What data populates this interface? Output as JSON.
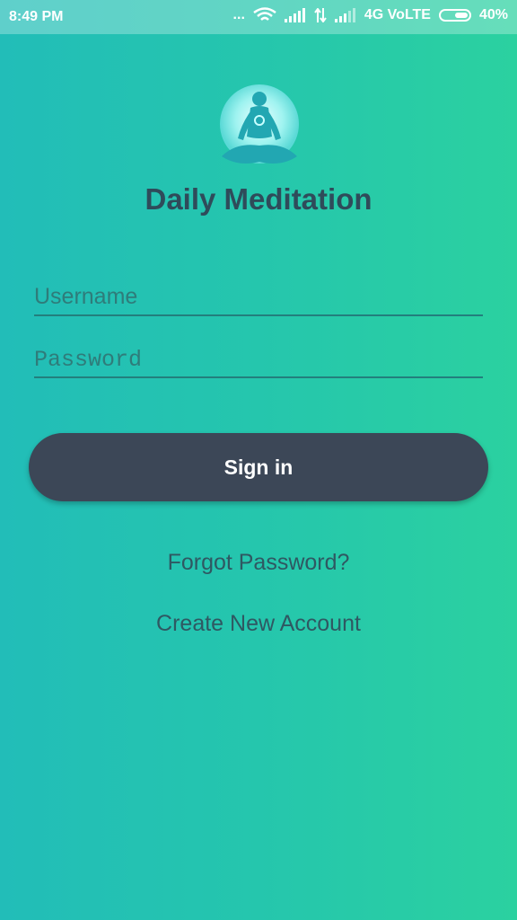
{
  "status_bar": {
    "time": "8:49 PM",
    "dots": "...",
    "network": "4G VoLTE",
    "battery": "40%",
    "battery_level": 0.4
  },
  "app": {
    "title": "Daily Meditation",
    "logo_icon": "meditation-figure-icon"
  },
  "form": {
    "username_placeholder": "Username",
    "password_placeholder": "Password",
    "signin_label": "Sign in"
  },
  "links": {
    "forgot": "Forgot Password?",
    "create": "Create New Account"
  },
  "colors": {
    "gradient_start": "#22bdb8",
    "gradient_end": "#2bd1a0",
    "button": "#3c4757",
    "title": "#2f4b5a"
  }
}
